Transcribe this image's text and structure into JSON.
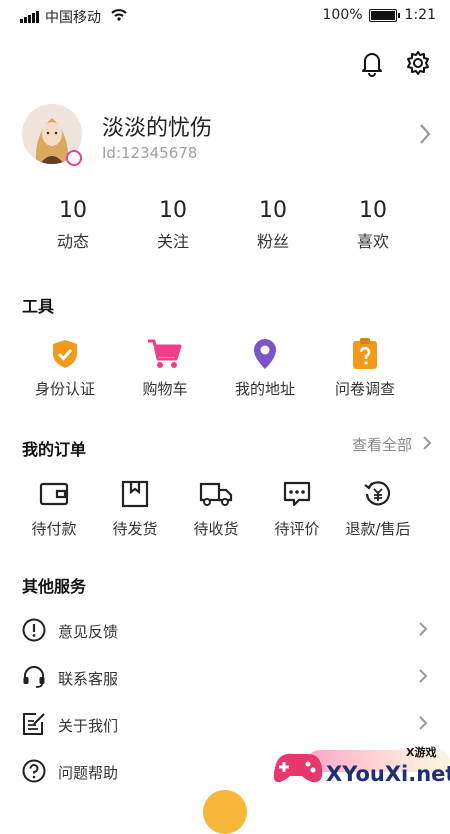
{
  "status_bar": {
    "carrier": "中国移动",
    "battery": "100%",
    "time": "1:21"
  },
  "header": {
    "notification_icon": "bell-icon",
    "settings_icon": "gear-icon"
  },
  "profile": {
    "name": "淡淡的忧伤",
    "id": "Id:12345678"
  },
  "stats": [
    {
      "value": "10",
      "label": "动态"
    },
    {
      "value": "10",
      "label": "关注"
    },
    {
      "value": "10",
      "label": "粉丝"
    },
    {
      "value": "10",
      "label": "喜欢"
    }
  ],
  "tools": {
    "title": "工具",
    "items": [
      {
        "label": "身份认证",
        "icon": "shield-check-icon",
        "color": "#f39a1a"
      },
      {
        "label": "购物车",
        "icon": "cart-icon",
        "color": "#ee3e87"
      },
      {
        "label": "我的地址",
        "icon": "location-pin-icon",
        "color": "#7b54c9"
      },
      {
        "label": "问卷调查",
        "icon": "questionnaire-icon",
        "color": "#f39a1a"
      }
    ]
  },
  "orders": {
    "title": "我的订单",
    "view_all": "查看全部",
    "items": [
      {
        "label": "待付款",
        "icon": "wallet-icon"
      },
      {
        "label": "待发货",
        "icon": "package-icon"
      },
      {
        "label": "待收货",
        "icon": "truck-icon"
      },
      {
        "label": "待评价",
        "icon": "comment-icon"
      },
      {
        "label": "退款/售后",
        "icon": "refund-icon"
      }
    ]
  },
  "services": {
    "title": "其他服务",
    "items": [
      {
        "label": "意见反馈",
        "icon": "feedback-icon"
      },
      {
        "label": "联系客服",
        "icon": "headset-icon"
      },
      {
        "label": "关于我们",
        "icon": "about-icon"
      },
      {
        "label": "问题帮助",
        "icon": "help-icon"
      }
    ]
  },
  "watermark": {
    "line1": "X游戏",
    "line2": "XYouXi.net"
  }
}
